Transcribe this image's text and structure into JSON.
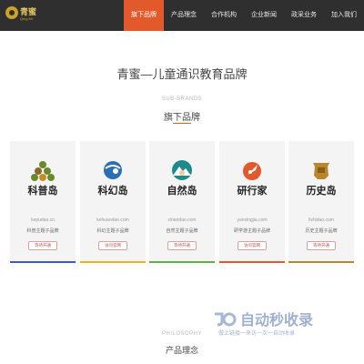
{
  "header": {
    "logo_text": "青蜜",
    "logo_sub": "Qing Mi",
    "nav": [
      {
        "label": "旗下品牌",
        "active": true
      },
      {
        "label": "产品理念",
        "active": false
      },
      {
        "label": "合作机构",
        "active": false
      },
      {
        "label": "企业新闻",
        "active": false
      },
      {
        "label": "政采业务",
        "active": false
      },
      {
        "label": "加入我们",
        "active": false
      }
    ]
  },
  "intro": {
    "title": "青蜜—儿童通识教育品牌"
  },
  "brands_section": {
    "en": "SUB-BRANDS",
    "cn": "旗下品牌"
  },
  "brands": [
    {
      "name": "科普岛",
      "domain": "kepudao.cn",
      "desc": "科普主题子品牌",
      "button": "等待开通",
      "color": "#3a5bd0",
      "icon": "tree-icon"
    },
    {
      "name": "科幻岛",
      "domain": "kehuandao.com",
      "desc": "科幻主题子品牌",
      "button": "访问官网",
      "color": "#e8b21f",
      "icon": "planet-icon"
    },
    {
      "name": "自然岛",
      "domain": "ziriandao.com",
      "desc": "自然主题子品牌",
      "button": "等待开通",
      "color": "#5ab33c",
      "icon": "mountain-icon"
    },
    {
      "name": "研行家",
      "domain": "yanxingjia.com",
      "desc": "研学游主题子品牌",
      "button": "访问官网",
      "color": "#e2592b",
      "icon": "rocket-icon"
    },
    {
      "name": "历史岛",
      "domain": "lishidao.com",
      "desc": "历史主题子品牌",
      "button": "等待开通",
      "color": "#b8862b",
      "icon": "pot-icon"
    }
  ],
  "philosophy_section": {
    "en": "PHILOSOPHY",
    "cn": "产品理念"
  },
  "watermark": {
    "title": "自动秒收录",
    "sub": "做上链接一来访一次一自动收录"
  }
}
